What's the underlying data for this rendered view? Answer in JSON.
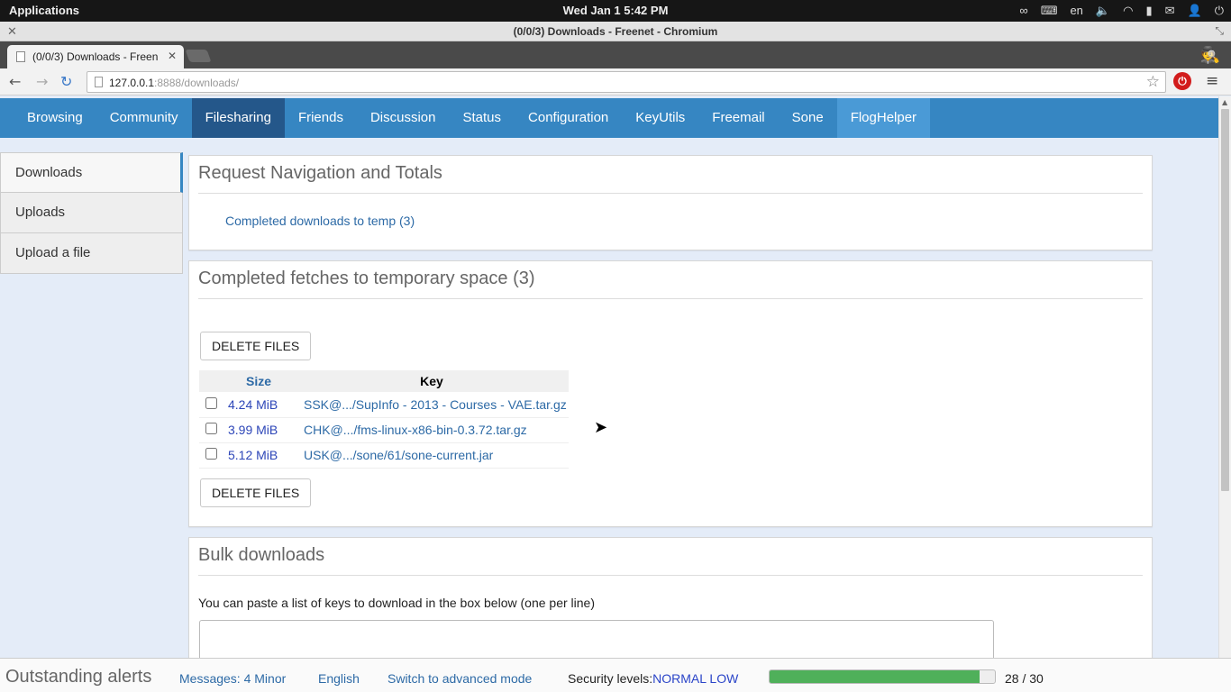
{
  "system": {
    "apps_label": "Applications",
    "clock": "Wed Jan  1  5:42 PM",
    "lang": "en"
  },
  "window": {
    "title": "(0/0/3) Downloads - Freenet - Chromium"
  },
  "tab": {
    "label": "(0/0/3) Downloads - Freen"
  },
  "address": {
    "host": "127.0.0.1",
    "rest": ":8888/downloads/"
  },
  "nav": [
    "Browsing",
    "Community",
    "Filesharing",
    "Friends",
    "Discussion",
    "Status",
    "Configuration",
    "KeyUtils",
    "Freemail",
    "Sone",
    "FlogHelper"
  ],
  "nav_active": "Filesharing",
  "sidebar": [
    "Downloads",
    "Uploads",
    "Upload a file"
  ],
  "request_nav": {
    "title": "Request Navigation and Totals",
    "link": "Completed downloads to temp (3)"
  },
  "completed": {
    "title": "Completed fetches to temporary space (3)",
    "delete_label": "DELETE FILES",
    "col_size": "Size",
    "col_key": "Key",
    "rows": [
      {
        "size": "4.24 MiB",
        "key": "SSK@.../SupInfo - 2013 - Courses - VAE.tar.gz"
      },
      {
        "size": "3.99 MiB",
        "key": "CHK@.../fms-linux-x86-bin-0.3.72.tar.gz"
      },
      {
        "size": "5.12 MiB",
        "key": "USK@.../sone/61/sone-current.jar"
      }
    ]
  },
  "bulk": {
    "title": "Bulk downloads",
    "text": "You can paste a list of keys to download in the box below (one per line)"
  },
  "statusbar": {
    "alerts": "Outstanding alerts",
    "messages": "Messages: 4 Minor",
    "language": "English",
    "advanced": "Switch to advanced mode",
    "security_label": "Security levels:",
    "security_value": "NORMAL LOW",
    "progress_text": "28 / 30",
    "progress_fraction": 0.93
  },
  "colors": {
    "nav_bg": "#3686c2",
    "nav_active": "#24578a",
    "link": "#2d6aa6",
    "progress": "#4fb05a"
  }
}
